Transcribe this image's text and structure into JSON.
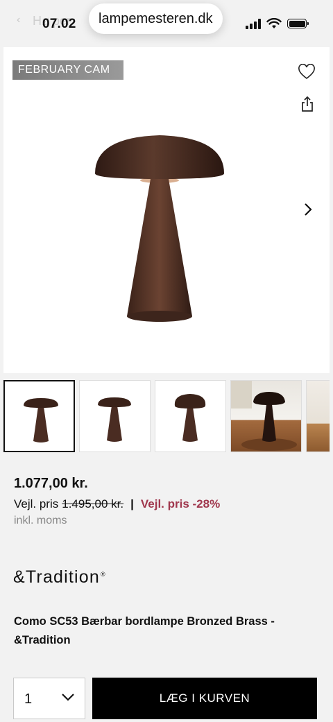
{
  "status_bar": {
    "time": "07.02",
    "back_hint": "‹",
    "ghost_text": "Hø         per"
  },
  "browser": {
    "url": "lampemesteren.dk"
  },
  "hero": {
    "promo_badge": "FEBRUARY CAM",
    "icons": [
      "heart-icon",
      "share-icon",
      "chevron-right-icon"
    ]
  },
  "thumbnails": [
    {
      "kind": "product",
      "active": true
    },
    {
      "kind": "product",
      "active": false
    },
    {
      "kind": "product-angle",
      "active": false
    },
    {
      "kind": "lifestyle-photo",
      "active": false
    },
    {
      "kind": "lifestyle-photo-partial",
      "active": false
    }
  ],
  "pricing": {
    "price": "1.077,00 kr.",
    "rrp_label": "Vejl. pris",
    "rrp_old": "1.495,00 kr.",
    "separator": "|",
    "discount": "Vejl. pris -28%",
    "vat_note": "inkl. moms"
  },
  "brand": {
    "name": "&Tradition",
    "mark": "®"
  },
  "product": {
    "title": "Como SC53 Bærbar bordlampe Bronzed Brass - &Tradition"
  },
  "cart": {
    "quantity": "1",
    "add_label": "LÆG I KURVEN"
  },
  "colors": {
    "discount": "#a0374d",
    "lamp_bronze": "#4a2c22",
    "button_bg": "#000000"
  }
}
